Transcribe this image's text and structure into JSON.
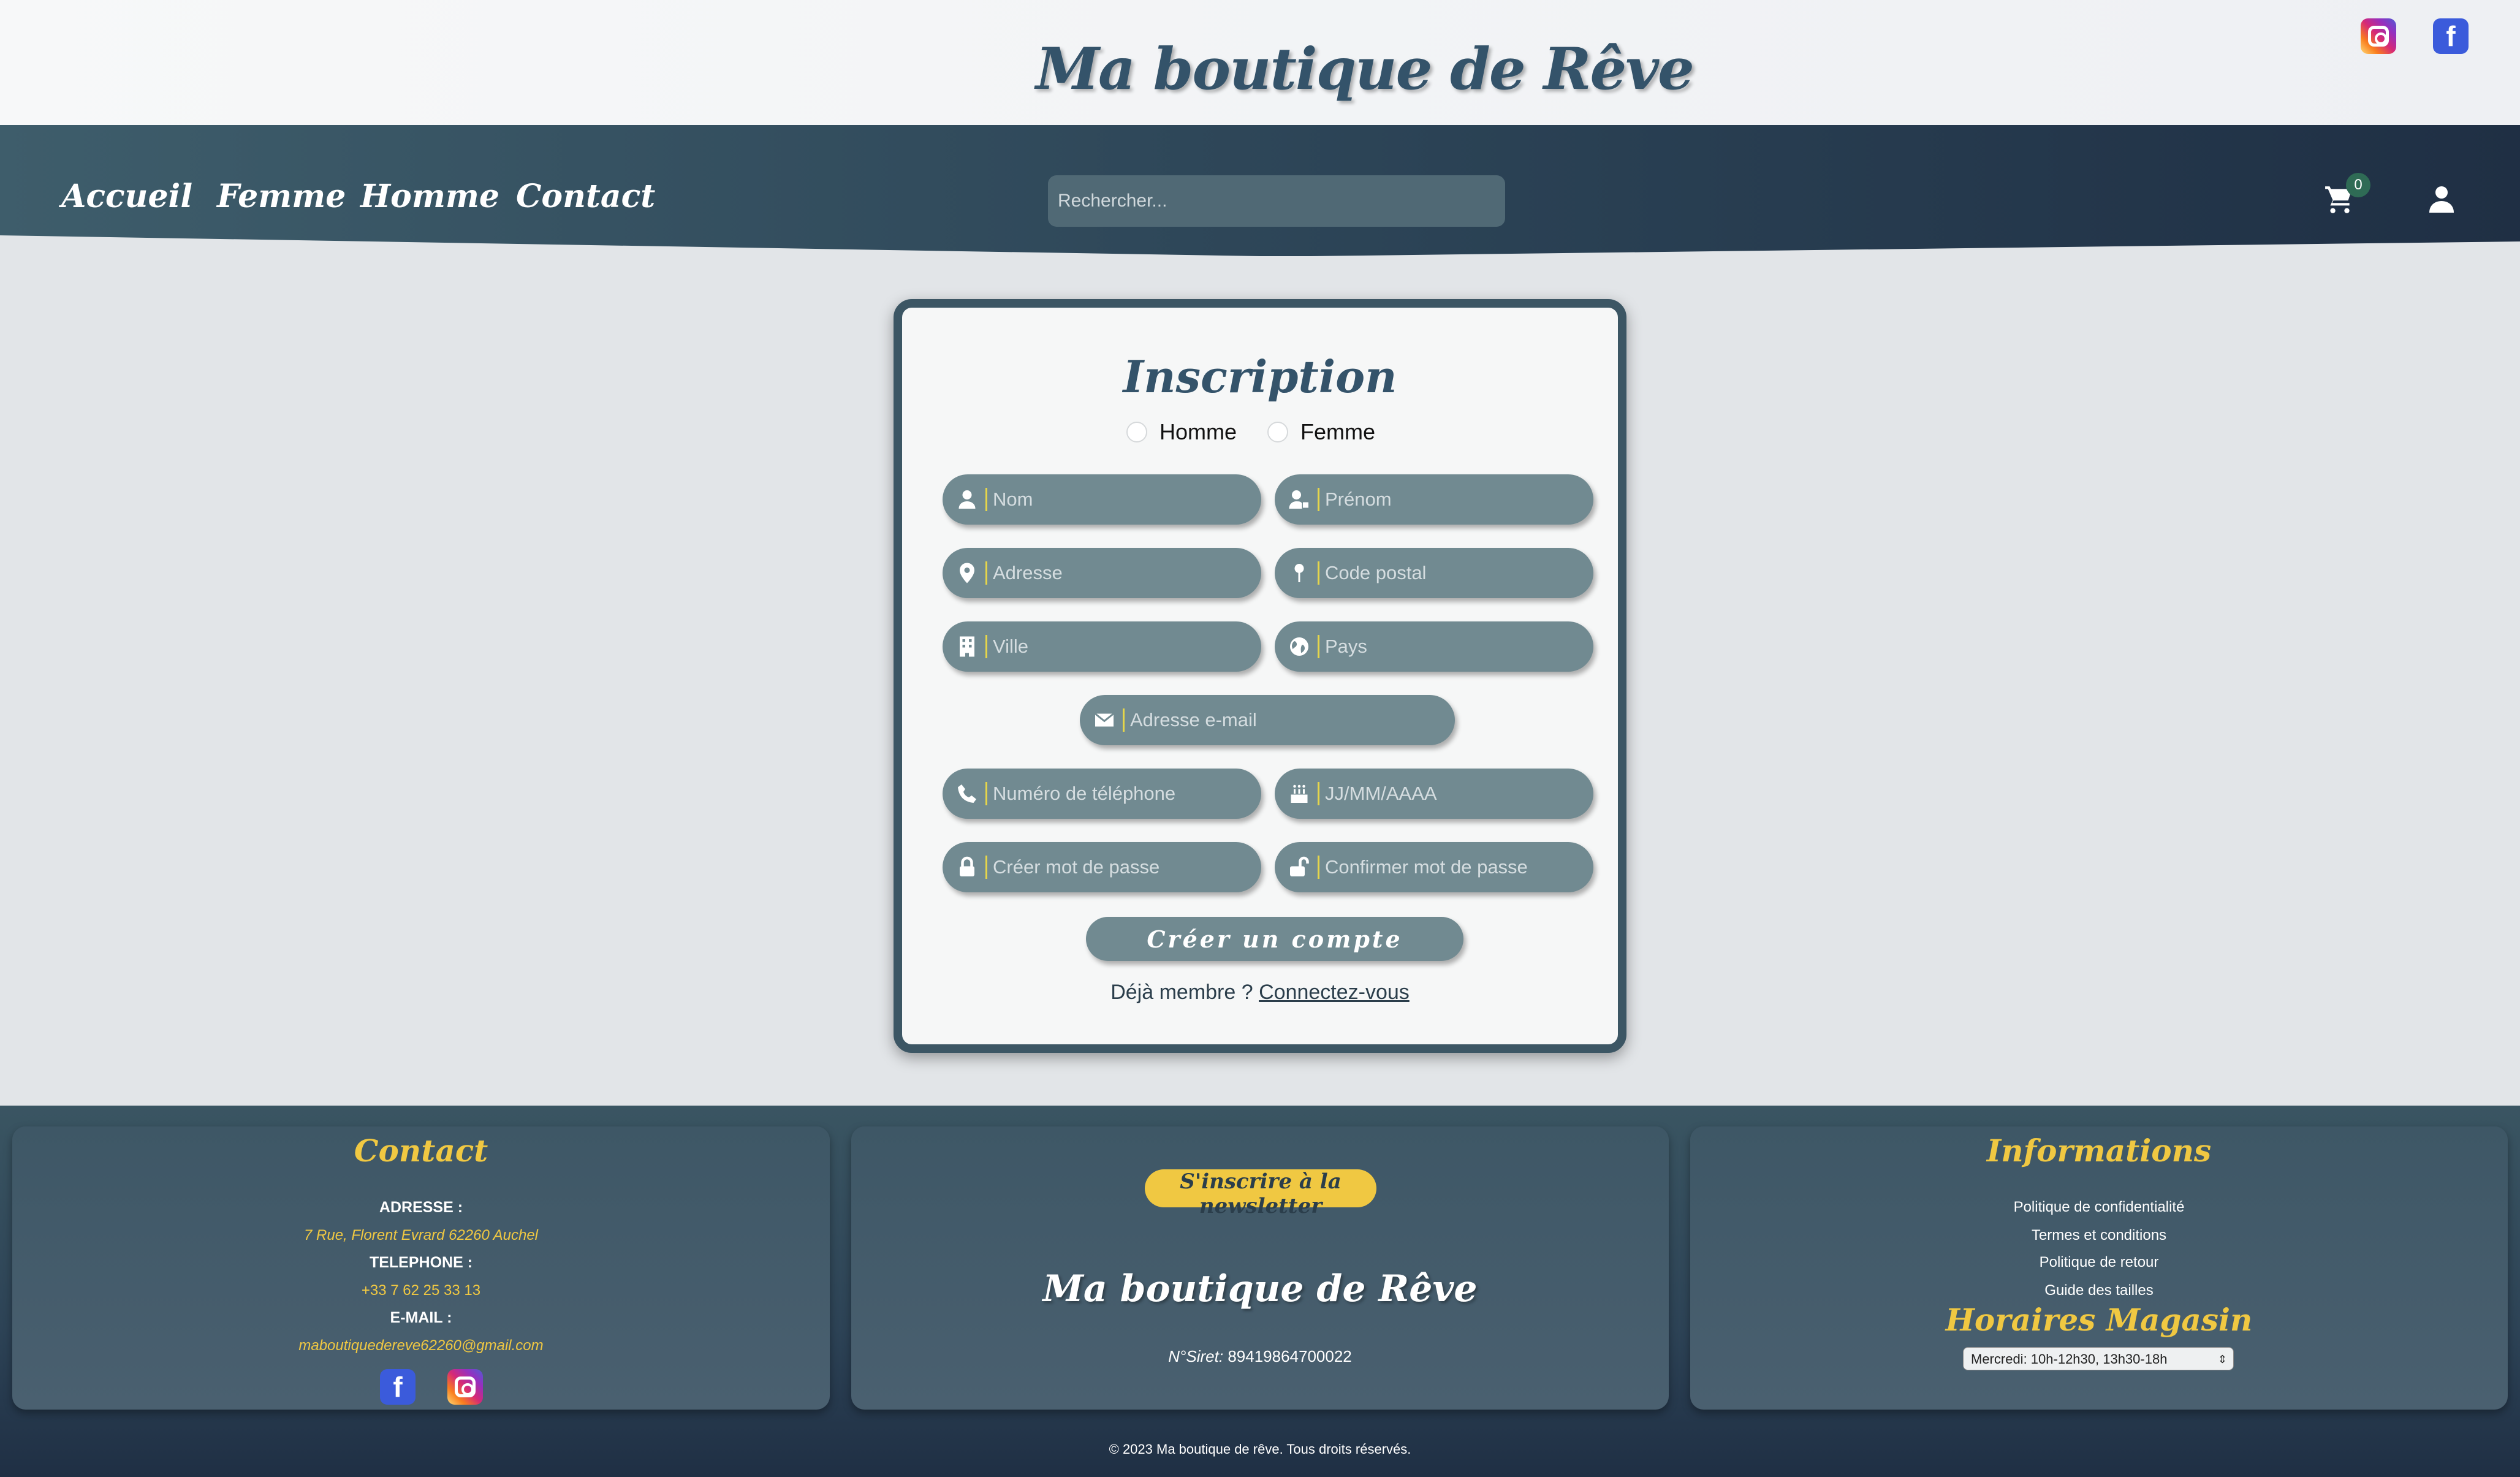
{
  "header": {
    "logo_text": "Ma boutique de Rêve",
    "social": {
      "instagram_icon": "instagram-icon",
      "facebook_icon": "facebook-icon"
    }
  },
  "nav": {
    "items": [
      {
        "label": "Accueil"
      },
      {
        "label": "Femme"
      },
      {
        "label": "Homme"
      },
      {
        "label": "Contact"
      }
    ],
    "search_placeholder": "Rechercher...",
    "cart_count": "0",
    "cart_icon": "cart-icon",
    "user_icon": "user-icon"
  },
  "form": {
    "title": "Inscription",
    "gender_options": [
      "Homme",
      "Femme"
    ],
    "fields": {
      "nom": "Nom",
      "prenom": "Prénom",
      "adresse": "Adresse",
      "code_postal": "Code postal",
      "ville": "Ville",
      "pays": "Pays",
      "email": "Adresse e-mail",
      "telephone": "Numéro de téléphone",
      "date": "JJ/MM/AAAA",
      "password": "Créer mot de passe",
      "confirm": "Confirmer mot de passe"
    },
    "submit_label": "Créer un compte",
    "member_text": "Déjà membre ?",
    "login_link": "Connectez-vous"
  },
  "footer": {
    "contact": {
      "title": "Contact",
      "address_label": "ADRESSE :",
      "address": "7 Rue, Florent Evrard 62260 Auchel",
      "phone_label": "TELEPHONE :",
      "phone": "+33 7 62 25 33 13",
      "email_label": "E-MAIL :",
      "email": "maboutiquedereve62260@gmail.com"
    },
    "center": {
      "newsletter_label": "S'inscrire à la newsletter",
      "logo_text": "Ma boutique de Rêve",
      "siret_label": "N°Siret:",
      "siret_value": "89419864700022"
    },
    "informations": {
      "title": "Informations",
      "links": [
        "Politique de confidentialité",
        "Termes et conditions",
        "Politique de retour",
        "Guide des tailles"
      ],
      "hours_title": "Horaires Magasin",
      "hours_selected": "Mercredi: 10h-12h30, 13h30-18h"
    },
    "copyright": "© 2023 Ma boutique de rêve. Tous droits réservés."
  },
  "colors": {
    "brand_dark": "#34536a",
    "accent_yellow": "#f0c842",
    "field_bg": "#718a91"
  }
}
